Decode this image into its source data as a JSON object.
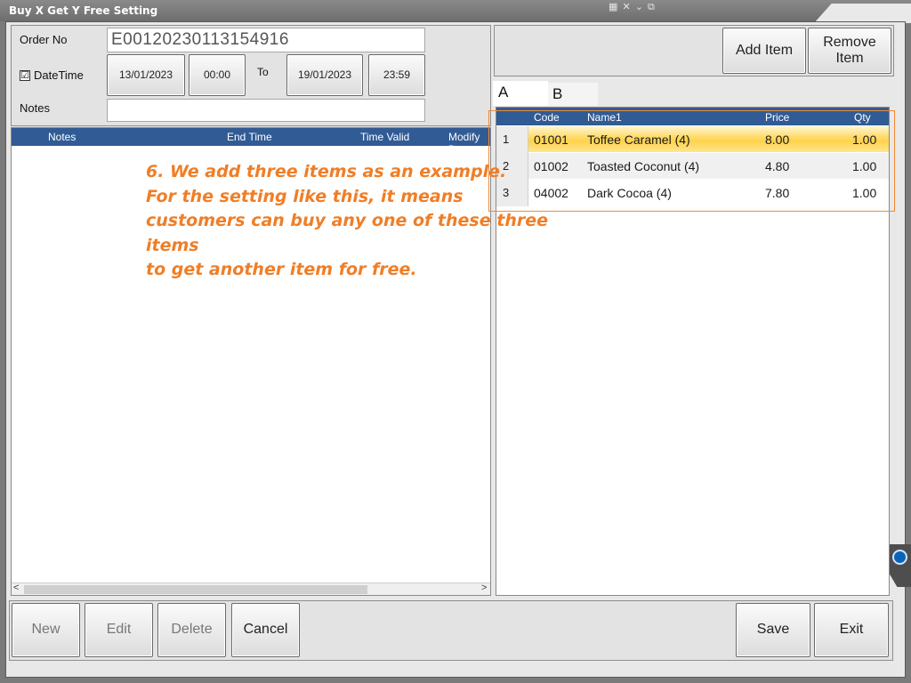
{
  "window": {
    "title": "Buy X Get Y Free Setting"
  },
  "form": {
    "order_no_label": "Order No",
    "order_no_value": "E00120230113154916",
    "datetime_label": "DateTime",
    "datetime_checked": "☑",
    "start_date": "13/01/2023",
    "start_time": "00:00",
    "to_label": "To",
    "end_date": "19/01/2023",
    "end_time": "23:59",
    "notes_label": "Notes",
    "notes_value": ""
  },
  "left_grid": {
    "columns": [
      "Notes",
      "End Time",
      "Time Valid",
      "Modify D"
    ]
  },
  "right_panel": {
    "add_item": "Add Item",
    "remove_item": "Remove Item",
    "tabs": [
      "A",
      "B"
    ],
    "columns": [
      "Code",
      "Name1",
      "Price",
      "Qty"
    ],
    "rows": [
      {
        "num": "1",
        "code": "01001",
        "name": "Toffee Caramel (4)",
        "price": "8.00",
        "qty": "1.00",
        "selected": true
      },
      {
        "num": "2",
        "code": "01002",
        "name": "Toasted Coconut (4)",
        "price": "4.80",
        "qty": "1.00"
      },
      {
        "num": "3",
        "code": "04002",
        "name": "Dark Cocoa (4)",
        "price": "7.80",
        "qty": "1.00"
      }
    ]
  },
  "annotation": {
    "lines": [
      "6. We add three items as an example.",
      "For the setting like this, it means",
      "customers can buy any one of these three items",
      "to get another item for free."
    ],
    "color": "#f07e26"
  },
  "bottom_bar": {
    "new": "New",
    "edit": "Edit",
    "delete": "Delete",
    "cancel": "Cancel",
    "save": "Save",
    "exit": "Exit"
  },
  "scroll": {
    "left_arrow": "<",
    "right_arrow": ">"
  }
}
